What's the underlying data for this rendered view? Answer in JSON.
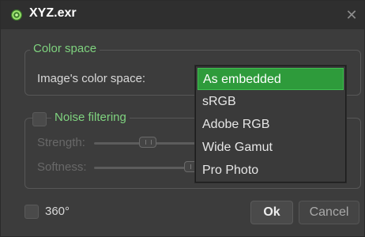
{
  "window": {
    "title": "XYZ.exr",
    "close_glyph": "✕",
    "icon": "gear-icon",
    "accent_color": "#7fd37f"
  },
  "color_space_group": {
    "legend": "Color space",
    "image_color_space_label": "Image's color space:"
  },
  "noise_filtering_group": {
    "legend": "Noise filtering",
    "strength_label": "Strength:",
    "softness_label": "Softness:",
    "strength_handle_label": ""
  },
  "options": {
    "three_sixty_label": "360°"
  },
  "buttons": {
    "ok_label": "Ok",
    "cancel_label": "Cancel"
  },
  "dropdown": {
    "selected": "As embedded",
    "items": [
      "As embedded",
      "sRGB",
      "Adobe RGB",
      "Wide Gamut",
      "Pro Photo"
    ],
    "selected_color": "#2e9b3b"
  }
}
